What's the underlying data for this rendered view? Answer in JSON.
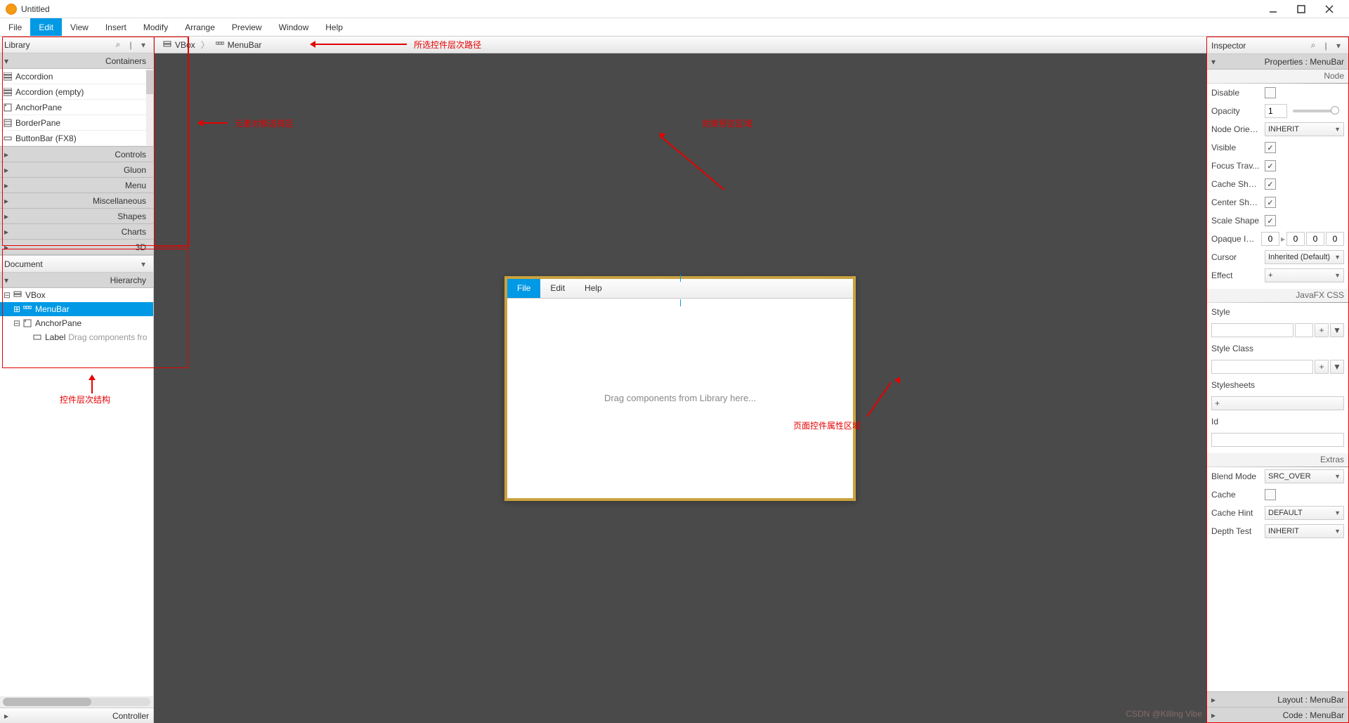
{
  "window": {
    "title": "Untitled"
  },
  "menubar": [
    "File",
    "Edit",
    "View",
    "Insert",
    "Modify",
    "Arrange",
    "Preview",
    "Window",
    "Help"
  ],
  "menubar_active": 1,
  "library": {
    "title": "Library",
    "sections": {
      "containers": {
        "title": "Containers",
        "items": [
          "Accordion",
          "Accordion  (empty)",
          "AnchorPane",
          "BorderPane",
          "ButtonBar  (FX8)"
        ]
      },
      "others": [
        "Controls",
        "Gluon",
        "Menu",
        "Miscellaneous",
        "Shapes",
        "Charts",
        "3D"
      ]
    }
  },
  "document": {
    "title": "Document",
    "hierarchy_label": "Hierarchy",
    "controller_label": "Controller",
    "tree": {
      "vbox": "VBox",
      "menubar": "MenuBar",
      "anchorpane": "AnchorPane",
      "label": "Label",
      "label_desc": "Drag components fro"
    }
  },
  "breadcrumb": [
    "VBox",
    "MenuBar"
  ],
  "preview": {
    "menu": [
      "File",
      "Edit",
      "Help"
    ],
    "placeholder": "Drag components from Library here..."
  },
  "inspector": {
    "title": "Inspector",
    "properties_hdr": "Properties : MenuBar",
    "node_label": "Node",
    "css_label": "JavaFX CSS",
    "extras_label": "Extras",
    "layout_label": "Layout : MenuBar",
    "code_label": "Code : MenuBar",
    "props": {
      "disable": "Disable",
      "opacity": "Opacity",
      "opacity_val": "1",
      "nodeOrien": "Node Orien...",
      "nodeOrien_val": "INHERIT",
      "visible": "Visible",
      "focusTrav": "Focus Trav...",
      "cacheShape": "Cache Shape",
      "centerShape": "Center Shape",
      "scaleShape": "Scale Shape",
      "opaqueIns": "Opaque Ins...",
      "oi0": "0",
      "oi1": "0",
      "oi2": "0",
      "oi3": "0",
      "cursor": "Cursor",
      "cursor_val": "Inherited (Default)",
      "effect": "Effect",
      "effect_val": "+",
      "style": "Style",
      "styleClass": "Style Class",
      "stylesheets": "Stylesheets",
      "id": "Id",
      "blendMode": "Blend Mode",
      "blendMode_val": "SRC_OVER",
      "cache": "Cache",
      "cacheHint": "Cache Hint",
      "cacheHint_val": "DEFAULT",
      "depthTest": "Depth Test",
      "depthTest_val": "INHERIT"
    }
  },
  "annotations": {
    "a1": "所选控件层次路径",
    "a2": "元素对象选择区",
    "a3": "效果预览区域",
    "a4": "控件层次结构",
    "a5": "页面控件属性区域",
    "watermark": "CSDN @Killing Vibe"
  }
}
